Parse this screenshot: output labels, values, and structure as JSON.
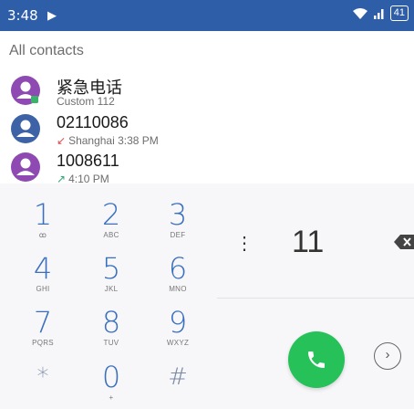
{
  "status_bar": {
    "time": "3:48",
    "battery": "41",
    "color": "#2f5ea9"
  },
  "contacts_header": "All contacts",
  "contacts": [
    {
      "name": "紧急电话",
      "sub": "Custom 112",
      "arrow": "",
      "avatar_color": "#8e4ab2"
    },
    {
      "name": "02110086",
      "sub": "Shanghai 3:38 PM",
      "arrow": "↙",
      "arrow_color": "#e04a4a",
      "avatar_color": "#3e62a6"
    },
    {
      "name": "1008611",
      "sub": "4:10 PM",
      "arrow": "↗",
      "arrow_color": "#2aa876",
      "avatar_color": "#8e4ab2"
    }
  ],
  "dialpad": {
    "keys": [
      {
        "num": "1",
        "letters": "ꝏ"
      },
      {
        "num": "2",
        "letters": "ABC"
      },
      {
        "num": "3",
        "letters": "DEF"
      },
      {
        "num": "4",
        "letters": "GHI"
      },
      {
        "num": "5",
        "letters": "JKL"
      },
      {
        "num": "6",
        "letters": "MNO"
      },
      {
        "num": "7",
        "letters": "PQRS"
      },
      {
        "num": "8",
        "letters": "TUV"
      },
      {
        "num": "9",
        "letters": "WXYZ"
      },
      {
        "num": "*",
        "letters": ""
      },
      {
        "num": "0",
        "letters": "+"
      },
      {
        "num": "#",
        "letters": ""
      }
    ]
  },
  "dialed_number": "11",
  "icons": {
    "menu": "more-vert-icon",
    "backspace": "backspace-icon",
    "call": "phone-icon",
    "more": "chevron-right-circle-icon"
  }
}
